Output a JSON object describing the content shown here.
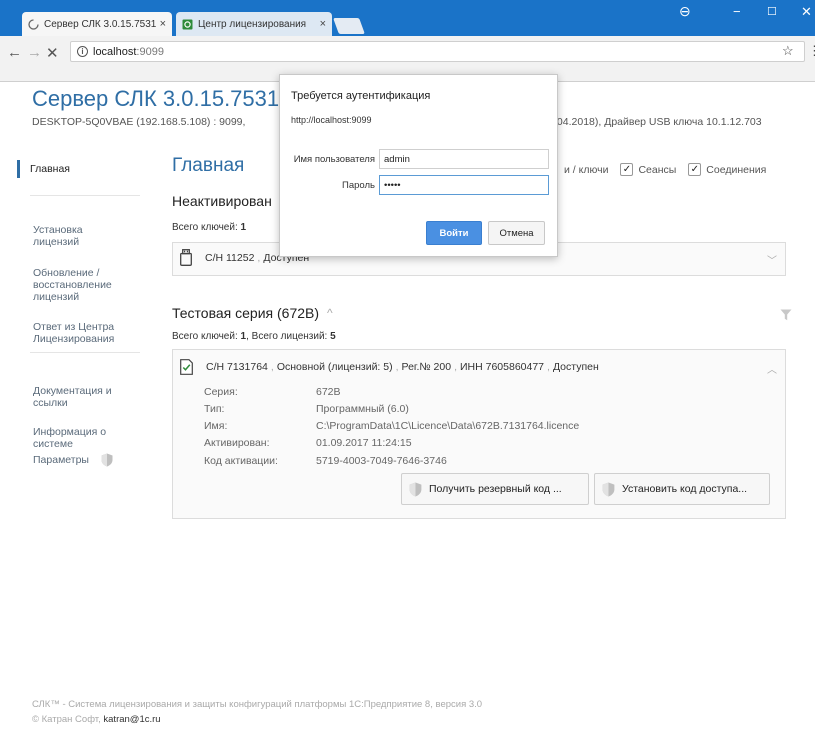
{
  "browser": {
    "tabs": [
      {
        "title": "Сервер СЛК 3.0.15.7531",
        "close": "×"
      },
      {
        "title": "Центр лицензирования",
        "close": "×"
      }
    ],
    "url_host": "localhost",
    "url_port": ":9099",
    "nav": {
      "back": "←",
      "forward": "→",
      "stop": "✕"
    },
    "star": "☆",
    "menu": "⋮",
    "window": {
      "profile": "⊖",
      "minimize": "−",
      "maximize": "☐",
      "close": "✕"
    }
  },
  "page": {
    "title": "Сервер СЛК 3.0.15.7531",
    "subline_left": "DESKTOP-5Q0VBAE (192.168.5.108) : 9099,",
    "subline_right": ".04.2018),  Драйвер USB ключа 10.1.12.703"
  },
  "sidebar": {
    "items": [
      {
        "label": "Главная"
      },
      {
        "label": "Установка\nлицензий"
      },
      {
        "label": "Обновление /\nвосстановление\nлицензий"
      },
      {
        "label": "Ответ из Центра\nЛицензирования"
      },
      {
        "label": "Документация и\nссылки"
      },
      {
        "label": "Информация о\nсистеме"
      },
      {
        "label": "Параметры"
      }
    ]
  },
  "main": {
    "heading": "Главная",
    "filters": {
      "partial_label": "и / ключи",
      "sessions": "Сеансы",
      "connections": "Соединения",
      "check": "✓"
    },
    "inactive": {
      "title": "Неактивирован",
      "meta_label": "Всего ключей:",
      "meta_count": "1",
      "card": {
        "serial": "С/Н 11252",
        "status": "Доступен"
      }
    },
    "test_series": {
      "title": "Тестовая серия (672B)",
      "caret": "^",
      "meta_keys_label": "Всего ключей:",
      "meta_keys": "1",
      "meta_lic_label": "Всего лицензий:",
      "meta_lic": "5",
      "card": {
        "serial": "С/Н 7131764",
        "type": "Основной (лицензий: 5)",
        "reg": "Рег.№ 200",
        "inn": "ИНН 7605860477",
        "status": "Доступен"
      },
      "details": [
        {
          "label": "Серия:",
          "value": "672B"
        },
        {
          "label": "Тип:",
          "value": "Программный (6.0)"
        },
        {
          "label": "Имя:",
          "value": "C:\\ProgramData\\1C\\Licence\\Data\\672B.7131764.licence"
        },
        {
          "label": "Активирован:",
          "value": "01.09.2017 11:24:15"
        },
        {
          "label": "Код активации:",
          "value": "5719-4003-7049-7646-3746"
        }
      ],
      "buttons": {
        "backup": "Получить резервный код ...",
        "access": "Установить код доступа..."
      }
    }
  },
  "footer": {
    "line1": "СЛК™ - Система лицензирования и защиты конфигураций платформы 1С:Предприятие 8, версия 3.0",
    "line2_prefix": "© Катран Софт,",
    "email": "katran@1c.ru"
  },
  "auth_dialog": {
    "title": "Требуется аутентификация",
    "url": "http://localhost:9099",
    "username_label": "Имя пользователя",
    "username_value": "admin",
    "password_label": "Пароль",
    "password_value": "•••••",
    "login_button": "Войти",
    "cancel_button": "Отмена"
  },
  "colors": {
    "brand_blue": "#2f6ea5",
    "titlebar": "#1a73c8",
    "primary_button": "#4a90e2"
  }
}
